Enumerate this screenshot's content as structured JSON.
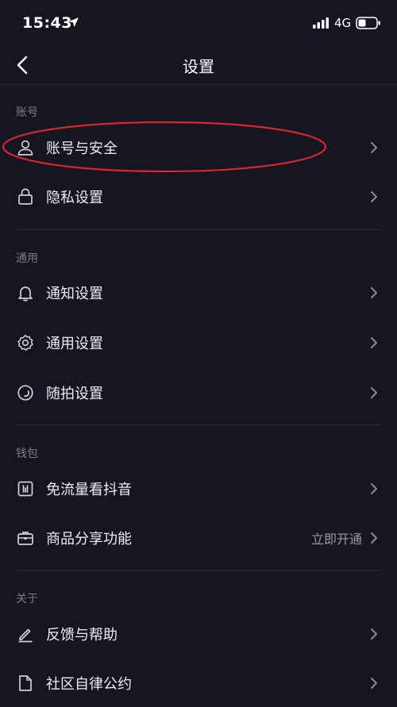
{
  "status": {
    "time": "15:43",
    "network": "4G"
  },
  "nav": {
    "title": "设置"
  },
  "sections": {
    "account": {
      "label": "账号",
      "items": [
        {
          "label": "账号与安全"
        },
        {
          "label": "隐私设置"
        }
      ]
    },
    "general": {
      "label": "通用",
      "items": [
        {
          "label": "通知设置"
        },
        {
          "label": "通用设置"
        },
        {
          "label": "随拍设置"
        }
      ]
    },
    "wallet": {
      "label": "钱包",
      "items": [
        {
          "label": "免流量看抖音"
        },
        {
          "label": "商品分享功能",
          "extra": "立即开通"
        }
      ]
    },
    "about": {
      "label": "关于",
      "items": [
        {
          "label": "反馈与帮助"
        },
        {
          "label": "社区自律公约"
        }
      ]
    }
  },
  "icons": {
    "account-security": "person-icon",
    "privacy": "lock-icon",
    "notifications": "bell-icon",
    "general": "gear-icon",
    "quick-shot": "circle-icon",
    "data-free": "chart-box-icon",
    "commerce": "briefcase-icon",
    "feedback": "pencil-icon",
    "community": "document-icon"
  },
  "colors": {
    "background": "#161622",
    "text_primary": "#ececf1",
    "text_secondary": "#7c7c88",
    "annotation": "#d9262c"
  }
}
